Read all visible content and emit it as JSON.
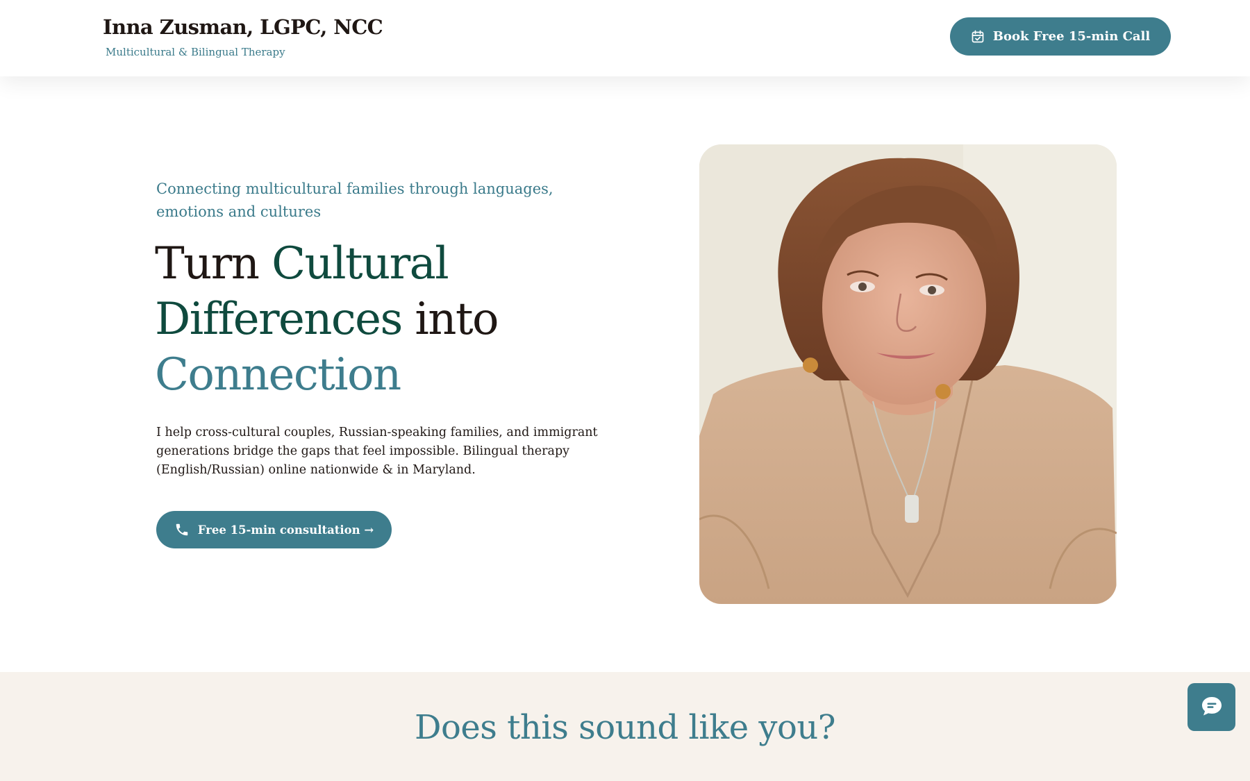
{
  "header": {
    "brand_name": "Inna Zusman, LGPC, NCC",
    "brand_tagline": "Multicultural & Bilingual Therapy",
    "cta_label": "Book Free 15-min Call",
    "cta_icon": "calendar-check-icon"
  },
  "hero": {
    "eyebrow": "Connecting multicultural families through languages, emotions and cultures",
    "title_parts": {
      "p1": "Turn ",
      "p2": "Cultural Differences",
      "p3": " into ",
      "p4": "Connection"
    },
    "body": "I help cross-cultural couples, Russian-speaking families, and immigrant generations bridge the gaps that feel impossible. Bilingual therapy (English/Russian) online nationwide & in Maryland.",
    "cta_label": "Free 15-min consultation →",
    "cta_icon": "phone-icon"
  },
  "section": {
    "title": "Does this sound like you?"
  },
  "chat": {
    "icon": "chat-bubble-icon"
  },
  "colors": {
    "accent": "#3e7d8d",
    "dark_green": "#0f4a3e",
    "text": "#1f1714",
    "section_bg": "#f7f2ec"
  }
}
